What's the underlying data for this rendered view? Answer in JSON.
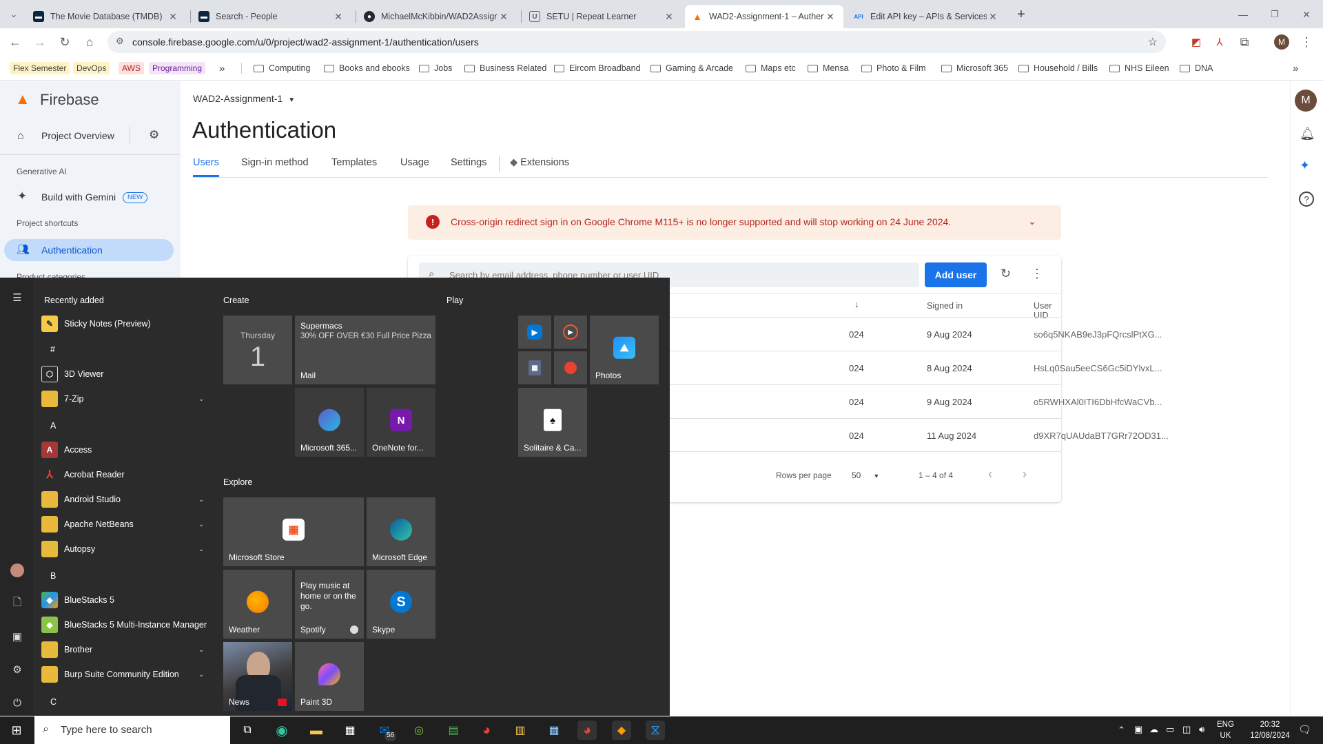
{
  "browser": {
    "tabs": [
      {
        "title": "The Movie Database (TMDB)",
        "favicon_color": "#0d253f",
        "active": false
      },
      {
        "title": "Search - People",
        "favicon_color": "#0d253f",
        "active": false
      },
      {
        "title": "MichaelMcKibbin/WAD2Assign…",
        "favicon_color": "#24292f",
        "active": false
      },
      {
        "title": "SETU | Repeat Learner",
        "favicon_color": "#5f6368",
        "active": false
      },
      {
        "title": "WAD2-Assignment-1 – Authent…",
        "favicon_color": "#ff6d00",
        "active": true
      },
      {
        "title": "Edit API key – APIs & Services…",
        "favicon_color": "#1a73e8",
        "active": false
      }
    ],
    "url": "console.firebase.google.com/u/0/project/wad2-assignment-1/authentication/users",
    "profile_initial": "M",
    "bookmark_pills": [
      "Flex Semester",
      "DevOps",
      "AWS",
      "Programming"
    ],
    "bookmark_overflow": "»",
    "bookmark_folders": [
      "Computing",
      "Books and ebooks",
      "Jobs",
      "Business Related",
      "Eircom Broadband",
      "Gaming & Arcade",
      "Maps etc",
      "Mensa",
      "Photo & Film",
      "Microsoft 365",
      "Household / Bills",
      "NHS Eileen",
      "DNA"
    ]
  },
  "firebase": {
    "brand": "Firebase",
    "project_overview": "Project Overview",
    "generative_ai": "Generative AI",
    "build_with_gemini": "Build with Gemini",
    "new_badge": "NEW",
    "project_shortcuts": "Project shortcuts",
    "authentication_item": "Authentication",
    "product_categories": "Product categories",
    "project_name": "WAD2-Assignment-1",
    "page_title": "Authentication",
    "tabs": [
      "Users",
      "Sign-in method",
      "Templates",
      "Usage",
      "Settings",
      "Extensions"
    ],
    "warning": "Cross-origin redirect sign in on Google Chrome M115+ is no longer supported and will stop working on 24 June 2024.",
    "search_placeholder": "Search by email address, phone number or user UID",
    "add_user": "Add user",
    "columns": {
      "signed_in": "Signed in",
      "user_uid": "User UID"
    },
    "rows": [
      {
        "created": "024",
        "signed_in": "9 Aug 2024",
        "uid": "so6q5NKAB9eJ3pFQrcslPtXG..."
      },
      {
        "created": "024",
        "signed_in": "8 Aug 2024",
        "uid": "HsLq0Sau5eeCS6Gc5iDYlvxL..."
      },
      {
        "created": "024",
        "signed_in": "9 Aug 2024",
        "uid": "o5RWHXAl0ITI6DbHfcWaCVb..."
      },
      {
        "created": "024",
        "signed_in": "11 Aug 2024",
        "uid": "d9XR7qUAUdaBT7GRr72OD31..."
      }
    ],
    "rows_per_page_label": "Rows per page",
    "rows_per_page_value": "50",
    "page_range": "1 – 4 of 4",
    "avatar_initial": "M"
  },
  "start_menu": {
    "recently_added": "Recently added",
    "apps": [
      {
        "label": "Sticky Notes (Preview)",
        "icon": "sticky-notes-icon",
        "color": "#f7c948",
        "glyph": "✎",
        "top": 0,
        "chevron": false
      },
      {
        "label": "3D Viewer",
        "icon": "cube-icon",
        "color": "#2b2b2b",
        "glyph": "⬡",
        "chevron": false
      },
      {
        "label": "7-Zip",
        "icon": "folder-icon",
        "color": "#e9b93b",
        "glyph": "",
        "chevron": true
      },
      {
        "label": "Access",
        "icon": "access-icon",
        "color": "#a4373a",
        "glyph": "A",
        "chevron": false
      },
      {
        "label": "Acrobat Reader",
        "icon": "acrobat-icon",
        "color": "#d32f2f",
        "glyph": "⅄",
        "chevron": false
      },
      {
        "label": "Android Studio",
        "icon": "folder-icon",
        "color": "#e9b93b",
        "glyph": "",
        "chevron": true
      },
      {
        "label": "Apache NetBeans",
        "icon": "folder-icon",
        "color": "#e9b93b",
        "glyph": "",
        "chevron": true
      },
      {
        "label": "Autopsy",
        "icon": "folder-icon",
        "color": "#e9b93b",
        "glyph": "",
        "chevron": true
      },
      {
        "label": "BlueStacks 5",
        "icon": "bluestacks-icon",
        "color": "#4caf50",
        "glyph": "◆",
        "chevron": false
      },
      {
        "label": "BlueStacks 5 Multi-Instance Manager",
        "icon": "bluestacks-icon",
        "color": "#8bc34a",
        "glyph": "◆",
        "chevron": false
      },
      {
        "label": "Brother",
        "icon": "folder-icon",
        "color": "#e9b93b",
        "glyph": "",
        "chevron": true
      },
      {
        "label": "Burp Suite Community Edition",
        "icon": "folder-icon",
        "color": "#e9b93b",
        "glyph": "",
        "chevron": true
      }
    ],
    "letters": [
      "#",
      "A",
      "B",
      "C"
    ],
    "groups": {
      "create": "Create",
      "play": "Play",
      "explore": "Explore"
    },
    "calendar": {
      "day": "Thursday",
      "date": "1"
    },
    "mail": {
      "from": "Supermacs",
      "preview": "30% OFF OVER €30 Full Price Pizza",
      "label": "Mail"
    },
    "tiles": {
      "m365": "Microsoft 365...",
      "onenote": "OneNote for...",
      "photos": "Photos",
      "solitaire": "Solitaire & Ca...",
      "store": "Microsoft Store",
      "edge": "Microsoft Edge",
      "weather": "Weather",
      "spotify_text": "Play music at home or on the go.",
      "spotify": "Spotify",
      "skype": "Skype",
      "news": "News",
      "paint3d": "Paint 3D"
    }
  },
  "taskbar": {
    "search_placeholder": "Type here to search",
    "mail_badge": "56",
    "lang": "ENG",
    "region": "UK",
    "time": "20:32",
    "date": "12/08/2024"
  }
}
